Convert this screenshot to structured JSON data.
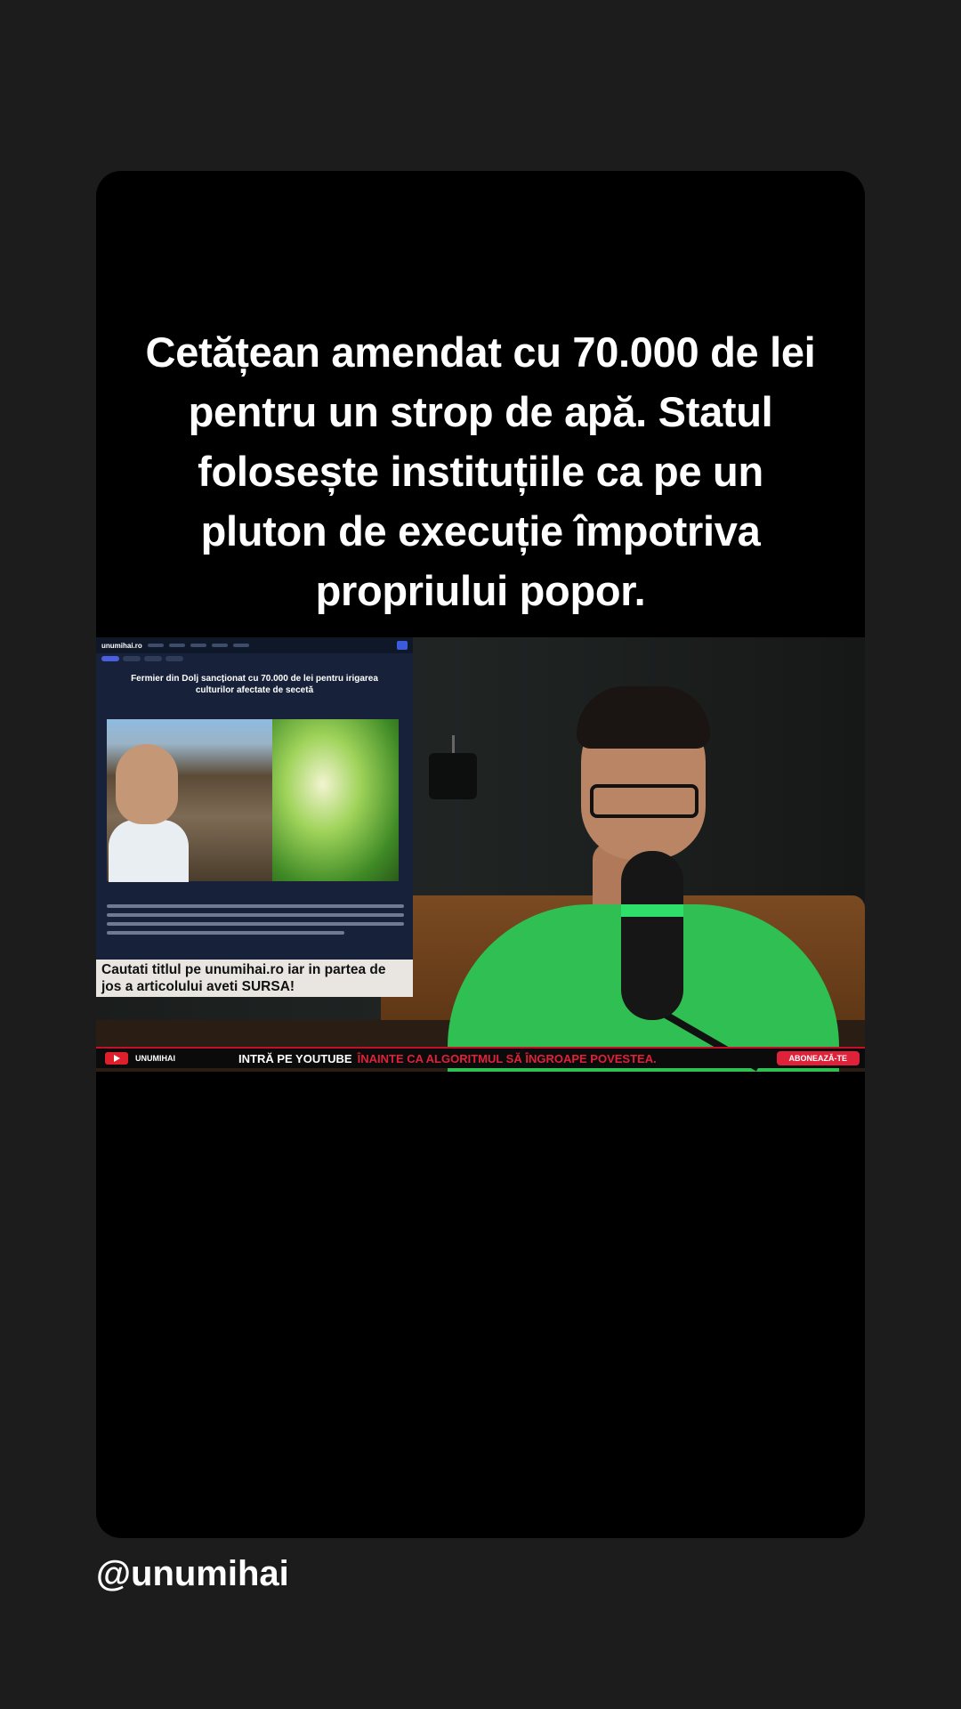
{
  "headline": "Cetățean amendat cu 70.000 de lei pentru un strop de apă. Statul folosește instituțiile ca pe un pluton de execuție împotriva propriului popor.",
  "article": {
    "site_logo": "unumihai.ro",
    "title": "Fermier din Dolj sancționat cu 70.000 de lei pentru irigarea culturilor afectate de secetă",
    "caption": "Cautati titlul pe unumihai.ro iar in partea de jos a articolului aveti SURSA!"
  },
  "ticker": {
    "brand": "UNUMIHAI",
    "white_text": "INTRĂ PE YOUTUBE",
    "red_text": "ÎNAINTE CA ALGORITMUL SĂ ÎNGROAPE POVESTEA.",
    "subscribe_label": "ABONEAZĂ-TE"
  },
  "handle": "@unumihai",
  "colors": {
    "background": "#1c1c1c",
    "card": "#000000",
    "accent_red": "#e0213a",
    "shirt_green": "#2fbf52"
  }
}
